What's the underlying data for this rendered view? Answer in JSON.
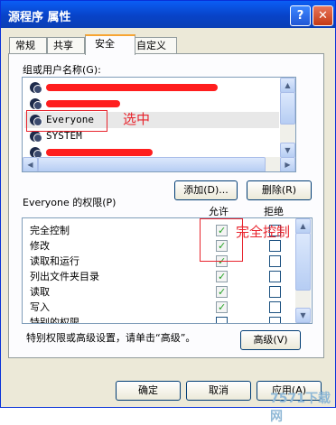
{
  "window": {
    "title": "源程序 属性",
    "help_button": "?",
    "close_button": "✕"
  },
  "tabs": [
    {
      "label": "常规"
    },
    {
      "label": "共享"
    },
    {
      "label": "安全"
    },
    {
      "label": "自定义"
    }
  ],
  "groups": {
    "label": "组或用户名称(G):",
    "items": [
      {
        "label": ""
      },
      {
        "label": ""
      },
      {
        "label": "Everyone"
      },
      {
        "label": "SYSTEM"
      },
      {
        "label": ""
      }
    ],
    "selected_index": 2,
    "add_button": "添加(D)...",
    "remove_button": "删除(R)"
  },
  "permissions": {
    "label": "Everyone 的权限(P)",
    "allow_header": "允许",
    "deny_header": "拒绝",
    "rows": [
      {
        "name": "完全控制",
        "allow": true,
        "deny": false
      },
      {
        "name": "修改",
        "allow": true,
        "deny": false
      },
      {
        "name": "读取和运行",
        "allow": true,
        "deny": false
      },
      {
        "name": "列出文件夹目录",
        "allow": true,
        "deny": false
      },
      {
        "name": "读取",
        "allow": true,
        "deny": false
      },
      {
        "name": "写入",
        "allow": true,
        "deny": false
      },
      {
        "name": "特别的权限",
        "allow": false,
        "deny": false
      }
    ]
  },
  "advanced": {
    "note": "特别权限或高级设置，请单击“高级”。",
    "button": "高级(V)"
  },
  "footer": {
    "ok": "确定",
    "cancel": "取消",
    "apply": "应用(A)"
  },
  "annotations": {
    "selected_note": "选中",
    "full_control_note": "完全控制",
    "watermark": "7571下载网"
  }
}
